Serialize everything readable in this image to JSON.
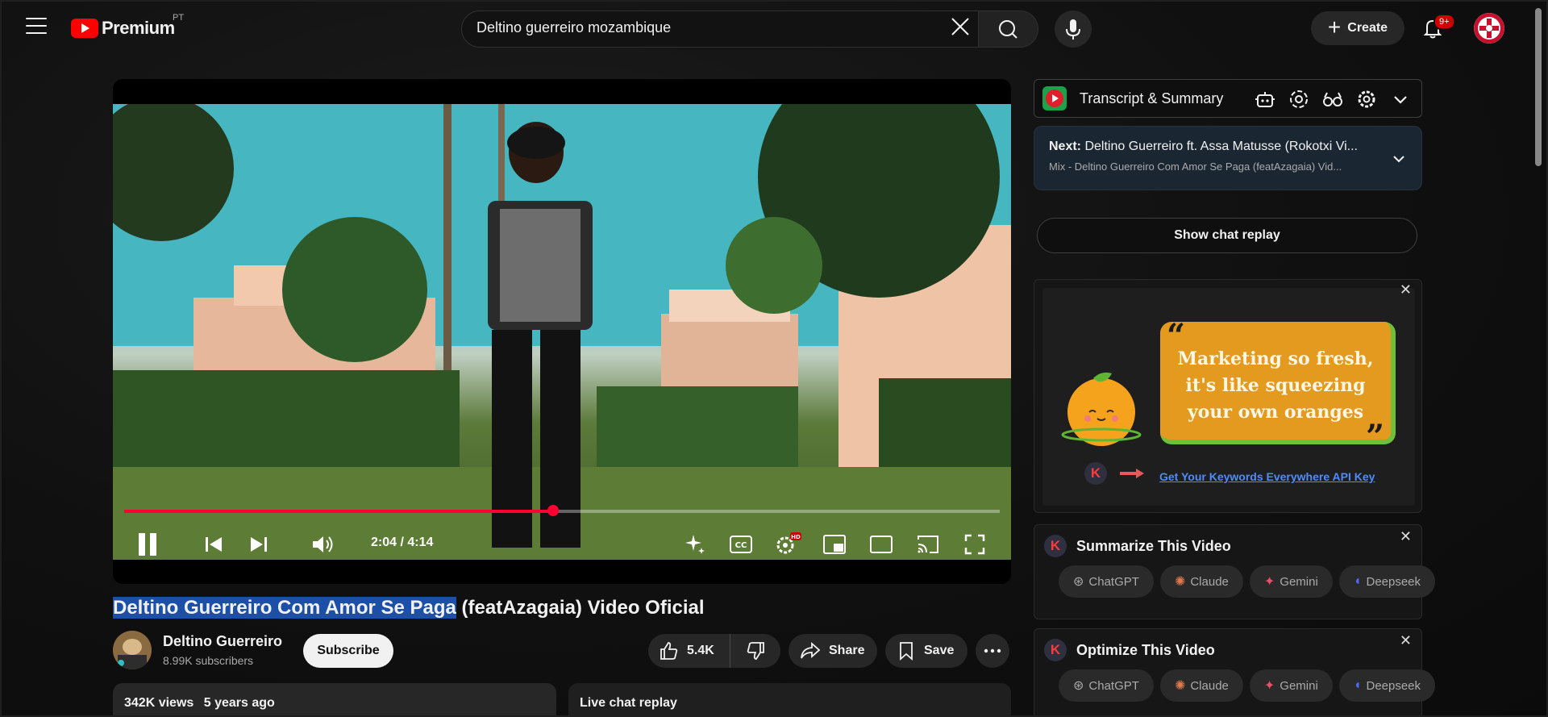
{
  "header": {
    "logo_text": "Premium",
    "country": "PT",
    "search_value": "Deltino guerreiro mozambique",
    "create_label": "Create",
    "notif_badge": "9+"
  },
  "player": {
    "time": "2:04 / 4:14",
    "progress": 0.49
  },
  "video": {
    "title_highlighted": "Deltino Guerreiro Com Amor Se Paga",
    "title_rest": " (featAzagaia) Video Oficial",
    "channel_name": "Deltino Guerreiro",
    "subscribers": "8.99K subscribers",
    "subscribe_label": "Subscribe",
    "likes": "5.4K",
    "share_label": "Share",
    "save_label": "Save",
    "views": "342K views",
    "age": "5 years ago",
    "live_chat_label": "Live chat replay"
  },
  "sidebar": {
    "transcript_title": "Transcript & Summary",
    "next_prefix": "Next:",
    "next_title": "Deltino Guerreiro ft. Assa Matusse (Rokotxi Vi...",
    "next_sub": "Mix - Deltino Guerreiro Com Amor Se Paga (featAzagaia) Vid...",
    "chat_replay_label": "Show chat replay",
    "ad": {
      "quote_line1": "Marketing so fresh,",
      "quote_line2": "it's like squeezing",
      "quote_line3": "your own oranges",
      "link": "Get Your Keywords Everywhere API Key"
    },
    "summarize_title": "Summarize This Video",
    "optimize_title": "Optimize This Video",
    "chips": [
      "ChatGPT",
      "Claude",
      "Gemini",
      "Deepseek"
    ]
  }
}
